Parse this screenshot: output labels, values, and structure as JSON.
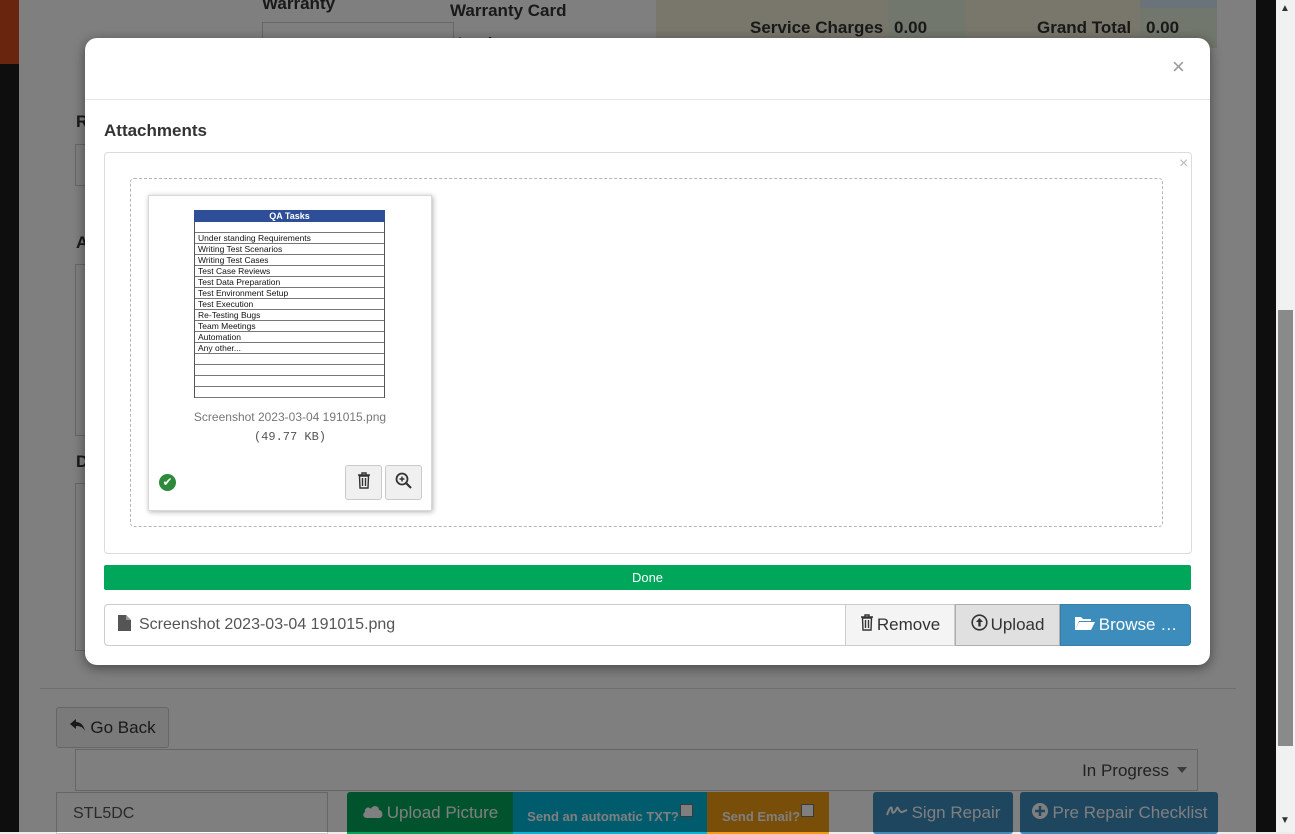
{
  "background": {
    "labels": {
      "warranty": "Warranty",
      "warranty_card_number": "Warranty Card\nNumber",
      "service_charges": "Service Charges",
      "service_charges_value": "0.00",
      "grand_total": "Grand Total",
      "grand_total_value": "0.00",
      "side_letter_r": "R",
      "side_letter_a": "A",
      "side_letter_d": "D"
    },
    "go_back_label": "Go Back",
    "status_select_value": "In Progress",
    "code_field_value": "STL5DC",
    "upload_picture_label": "Upload Picture",
    "send_txt_label": "Send an automatic TXT?",
    "send_email_label": "Send Email?",
    "sign_repair_label": "Sign Repair",
    "pre_repair_checklist_label": "Pre Repair Checklist",
    "colors": {
      "topbar": "#d34a1b",
      "upload_picture": "#00a65a",
      "send_txt": "#00b8d9",
      "send_email": "#f39c12",
      "sign_repair": "#3c8dbc"
    }
  },
  "modal": {
    "close_glyph": "×",
    "attachments_title": "Attachments",
    "box_close_glyph": "×",
    "file": {
      "thumbnail_title": "QA Tasks",
      "thumbnail_rows": [
        "",
        "Under standing Requirements",
        "Writing Test Scenarios",
        "Writing Test Cases",
        "Test Case Reviews",
        "Test Data Preparation",
        "Test Environment Setup",
        "Test Execution",
        "Re-Testing Bugs",
        "Team Meetings",
        "Automation",
        "Any other...",
        "",
        "",
        "",
        ""
      ],
      "name": "Screenshot 2023-03-04 191015.png",
      "size": "(49.77 KB)",
      "status_icon": "check-circle-icon"
    },
    "progress_label": "Done",
    "caption_filename": "Screenshot 2023-03-04 191015.png",
    "remove_label": "Remove",
    "upload_label": "Upload",
    "browse_label": "Browse …",
    "colors": {
      "done": "#00a65a",
      "browse": "#3c8dbc"
    }
  }
}
